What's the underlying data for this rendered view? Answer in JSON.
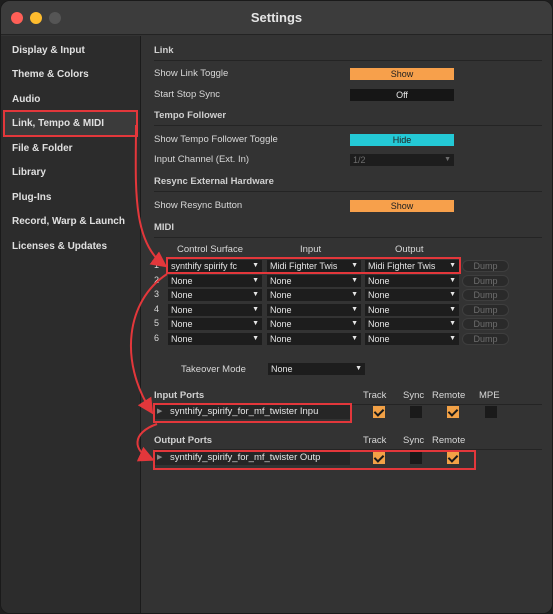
{
  "window": {
    "title": "Settings"
  },
  "sidebar": {
    "items": [
      {
        "label": "Display & Input"
      },
      {
        "label": "Theme & Colors"
      },
      {
        "label": "Audio"
      },
      {
        "label": "Link, Tempo & MIDI"
      },
      {
        "label": "File & Folder"
      },
      {
        "label": "Library"
      },
      {
        "label": "Plug-Ins"
      },
      {
        "label": "Record, Warp & Launch"
      },
      {
        "label": "Licenses & Updates"
      }
    ],
    "selected": "Link, Tempo & MIDI"
  },
  "link": {
    "section": "Link",
    "show_link_toggle_label": "Show Link Toggle",
    "show_link_toggle_value": "Show",
    "start_stop_sync_label": "Start Stop Sync",
    "start_stop_sync_value": "Off"
  },
  "tempo_follower": {
    "section": "Tempo Follower",
    "show_toggle_label": "Show Tempo Follower Toggle",
    "show_toggle_value": "Hide",
    "input_channel_label": "Input Channel (Ext. In)",
    "input_channel_value": "1/2"
  },
  "resync": {
    "section": "Resync External Hardware",
    "show_button_label": "Show Resync Button",
    "show_button_value": "Show"
  },
  "midi": {
    "section": "MIDI",
    "columns": {
      "control_surface": "Control Surface",
      "input": "Input",
      "output": "Output"
    },
    "rows": [
      {
        "num": "1",
        "surface": "synthify spirify fc",
        "input": "Midi Fighter Twis",
        "output": "Midi Fighter Twis",
        "dump": "Dump"
      },
      {
        "num": "2",
        "surface": "None",
        "input": "None",
        "output": "None",
        "dump": "Dump"
      },
      {
        "num": "3",
        "surface": "None",
        "input": "None",
        "output": "None",
        "dump": "Dump"
      },
      {
        "num": "4",
        "surface": "None",
        "input": "None",
        "output": "None",
        "dump": "Dump"
      },
      {
        "num": "5",
        "surface": "None",
        "input": "None",
        "output": "None",
        "dump": "Dump"
      },
      {
        "num": "6",
        "surface": "None",
        "input": "None",
        "output": "None",
        "dump": "Dump"
      }
    ],
    "takeover_label": "Takeover Mode",
    "takeover_value": "None"
  },
  "input_ports": {
    "header": "Input Ports",
    "col_track": "Track",
    "col_sync": "Sync",
    "col_remote": "Remote",
    "col_mpe": "MPE",
    "port_name": "synthify_spirify_for_mf_twister Inpu",
    "track": true,
    "sync": false,
    "remote": true,
    "mpe": false
  },
  "output_ports": {
    "header": "Output Ports",
    "col_track": "Track",
    "col_sync": "Sync",
    "col_remote": "Remote",
    "port_name": "synthify_spirify_for_mf_twister Outp",
    "track": true,
    "sync": false,
    "remote": true
  },
  "colors": {
    "accent_orange": "#f7a04b",
    "accent_cyan": "#24c9d6",
    "annotation_red": "#e3373b"
  }
}
